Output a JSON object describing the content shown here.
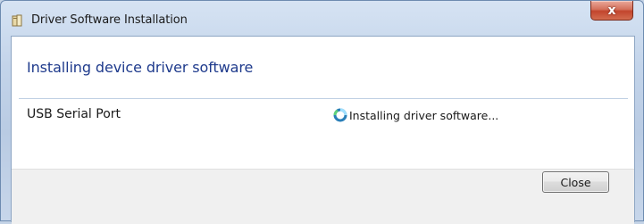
{
  "window": {
    "title": "Driver Software Installation",
    "close_glyph": "x"
  },
  "main": {
    "heading": "Installing device driver software",
    "device": {
      "name": "USB Serial Port",
      "status": "Installing driver software...",
      "status_icon": "spinner-icon"
    }
  },
  "footer": {
    "close_label": "Close"
  },
  "colors": {
    "heading": "#1e3a8c",
    "close_x": "#c2452d",
    "frame": "#c3d4ea"
  }
}
